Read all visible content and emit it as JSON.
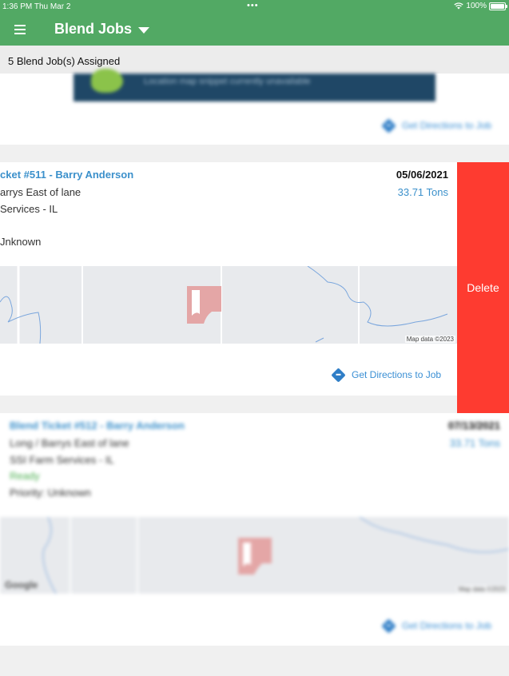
{
  "status_bar": {
    "time": "1:36 PM  Thu Mar 2",
    "dots": "•••",
    "battery": "100%"
  },
  "header": {
    "title": "Blend Jobs"
  },
  "assigned": "5 Blend Job(s) Assigned",
  "top_card": {
    "map_message": "Location map snippet currently unavailable",
    "directions": "Get Directions to Job"
  },
  "job_511": {
    "title": "cket #511 - Barry Anderson",
    "farm": "arrys East of lane",
    "vendor": " Services - IL",
    "priority": "Jnknown",
    "date": "05/06/2021",
    "amount": "33.71 Tons",
    "map_credit": "Map data ©2023",
    "directions": "Get Directions to Job",
    "delete_label": "Delete"
  },
  "job_512": {
    "title": "Blend Ticket #512 - Barry Anderson",
    "farm": "Long / Barrys East of lane",
    "vendor": "SSI Farm Services - IL",
    "status": "Ready",
    "priority": "Priority: Unknown",
    "date": "07/13/2021",
    "amount": "33.71 Tons",
    "map_brand": "Google",
    "map_credit": "Map data ©2023",
    "directions": "Get Directions to Job"
  },
  "colors": {
    "header_green": "#52a964",
    "link_blue": "#3b90cb",
    "delete_red": "#fe3b30",
    "status_green": "#4caf50"
  }
}
